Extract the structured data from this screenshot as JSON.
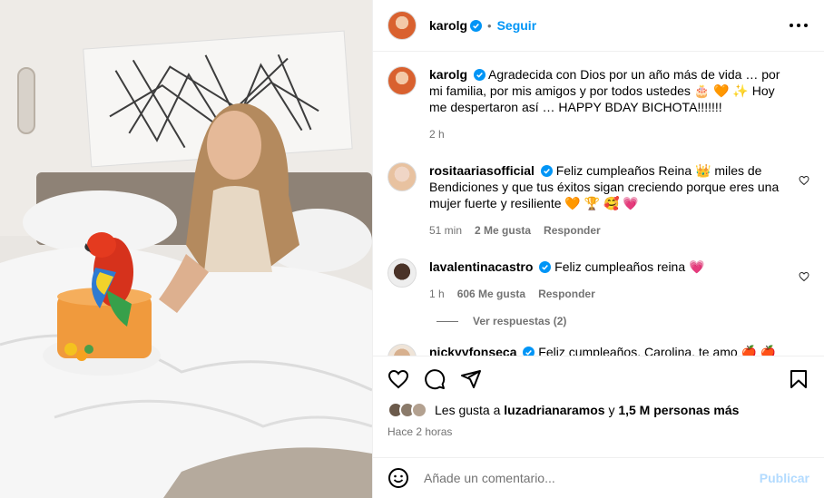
{
  "post": {
    "author": "karolg",
    "follow_label": "Seguir",
    "dot": "•",
    "caption": {
      "username": "karolg",
      "text": "Agradecida con Dios por un año más de vida … por mi familia, por mis amigos y por todos ustedes 🎂 🧡 ✨ Hoy me despertaron así … HAPPY BDAY BICHOTA!!!!!!!",
      "time": "2 h"
    },
    "comments": [
      {
        "username": "rositaariasofficial",
        "text": "Feliz cumpleaños Reina 👑 miles de Bendiciones y que tus éxitos sigan creciendo porque eres una mujer fuerte y resiliente 🧡 🏆 🥰 💗",
        "time": "51 min",
        "likes": "2 Me gusta",
        "reply": "Responder"
      },
      {
        "username": "lavalentinacastro",
        "text": "Feliz cumpleaños reina 💗",
        "time": "1 h",
        "likes": "606 Me gusta",
        "reply": "Responder"
      },
      {
        "username": "nickyyfonseca",
        "text": "Feliz cumpleaños, Carolina, te amo 🍎 🍎 🍎",
        "time": "",
        "likes": "",
        "reply": ""
      }
    ],
    "view_replies": "Ver respuestas (2)",
    "likes_prefix": "Les gusta a",
    "likes_user": "luzadrianaramos",
    "likes_mid": "y",
    "likes_count": "1,5 M personas más",
    "posted": "Hace 2 horas",
    "comment_placeholder": "Añade un comentario...",
    "publish_label": "Publicar"
  },
  "icons": [
    "more-icon",
    "heart-icon",
    "comment-icon",
    "share-icon",
    "save-icon",
    "emoji-icon",
    "verified-icon"
  ],
  "colors": {
    "accent": "#0095f6",
    "publish_disabled": "#b3dbff",
    "text_secondary": "#737373",
    "heart": "#e8005a"
  }
}
